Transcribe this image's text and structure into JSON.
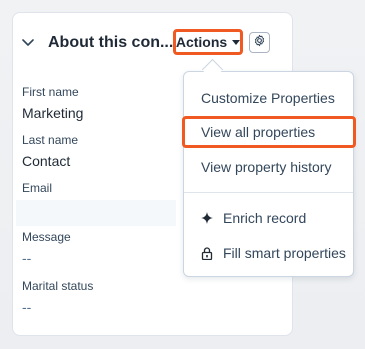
{
  "card": {
    "title": "About this con...",
    "fields": [
      {
        "label": "First name",
        "value": "Marketing"
      },
      {
        "label": "Last name",
        "value": "Contact"
      },
      {
        "label": "Email",
        "value": ""
      },
      {
        "label": "Message",
        "value": "--"
      },
      {
        "label": "Marital status",
        "value": "--"
      }
    ]
  },
  "toolbar": {
    "actions_label": "Actions"
  },
  "menu": {
    "items": [
      {
        "label": "Customize Properties",
        "icon": ""
      },
      {
        "label": "View all properties",
        "icon": ""
      },
      {
        "label": "View property history",
        "icon": ""
      },
      {
        "label": "Enrich record",
        "icon": "sparkle-icon"
      },
      {
        "label": "Fill smart properties",
        "icon": "lock-icon"
      }
    ]
  },
  "colors": {
    "highlight": "#f05a22",
    "text_primary": "#1f2a36",
    "text_secondary": "#33475b"
  }
}
